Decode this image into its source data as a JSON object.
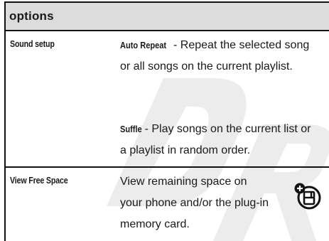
{
  "header": {
    "title": "options"
  },
  "rows": [
    {
      "name": "Sound setup",
      "entries": [
        {
          "term": "Auto Repeat",
          "text": " - Repeat the selected song or all songs on the current playlist."
        },
        {
          "term": "Suffle",
          "text": " - Play songs on the current list or a playlist in random order."
        }
      ]
    },
    {
      "name": "View Free Space",
      "description": "View remaining space on your phone and/or the plug-in memory card.",
      "icon": "memory-card-feature-icon"
    }
  ],
  "watermark": "DR"
}
